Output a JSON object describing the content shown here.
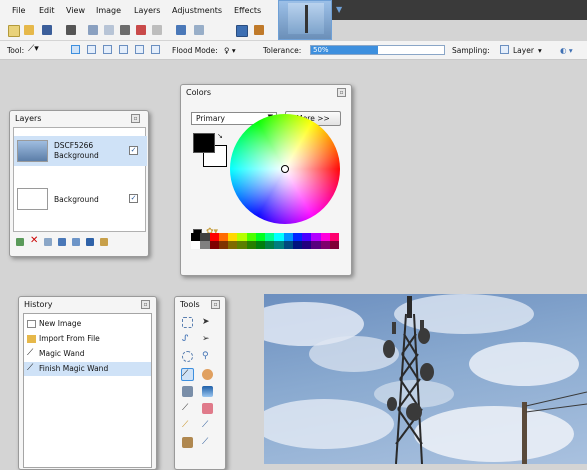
{
  "menu": [
    "File",
    "Edit",
    "View",
    "Image",
    "Layers",
    "Adjustments",
    "Effects"
  ],
  "toolbar2": {
    "tool_label": "Tool:",
    "flood_mode_label": "Flood Mode:",
    "tolerance_label": "Tolerance:",
    "tolerance_value": "50%",
    "tolerance_fraction": 0.5,
    "sampling_label": "Sampling:",
    "sampling_value": "Layer"
  },
  "layers_panel": {
    "title": "Layers",
    "items": [
      {
        "name": "DSCF5266",
        "sub": "Background",
        "checked": true,
        "selected": true
      },
      {
        "name": "Background",
        "checked": true,
        "selected": false
      }
    ]
  },
  "colors_panel": {
    "title": "Colors",
    "mode_select": "Primary",
    "more_button": "More >>",
    "primary_color": "#000000",
    "secondary_color": "#ffffff"
  },
  "history_panel": {
    "title": "History",
    "items": [
      {
        "label": "New Image",
        "icon": "new-image-icon",
        "selected": false
      },
      {
        "label": "Import From File",
        "icon": "import-icon",
        "selected": false
      },
      {
        "label": "Magic Wand",
        "icon": "magic-wand-icon",
        "selected": false
      },
      {
        "label": "Finish Magic Wand",
        "icon": "magic-wand-icon",
        "selected": true
      }
    ]
  },
  "tools_panel": {
    "title": "Tools",
    "tools": [
      "rectangle-select-icon",
      "move-selection-icon",
      "lasso-select-icon",
      "move-selected-icon",
      "ellipse-select-icon",
      "zoom-icon",
      "magic-wand-icon",
      "pan-icon",
      "paint-bucket-icon",
      "gradient-icon",
      "paintbrush-icon",
      "eraser-icon",
      "pencil-icon",
      "color-picker-icon",
      "clone-stamp-icon",
      "recolor-icon"
    ]
  },
  "accent_colors": {
    "selection": "#cfe2f7",
    "tolerance_fill": "#3d8fde",
    "panel_border": "#9a9a9a"
  }
}
